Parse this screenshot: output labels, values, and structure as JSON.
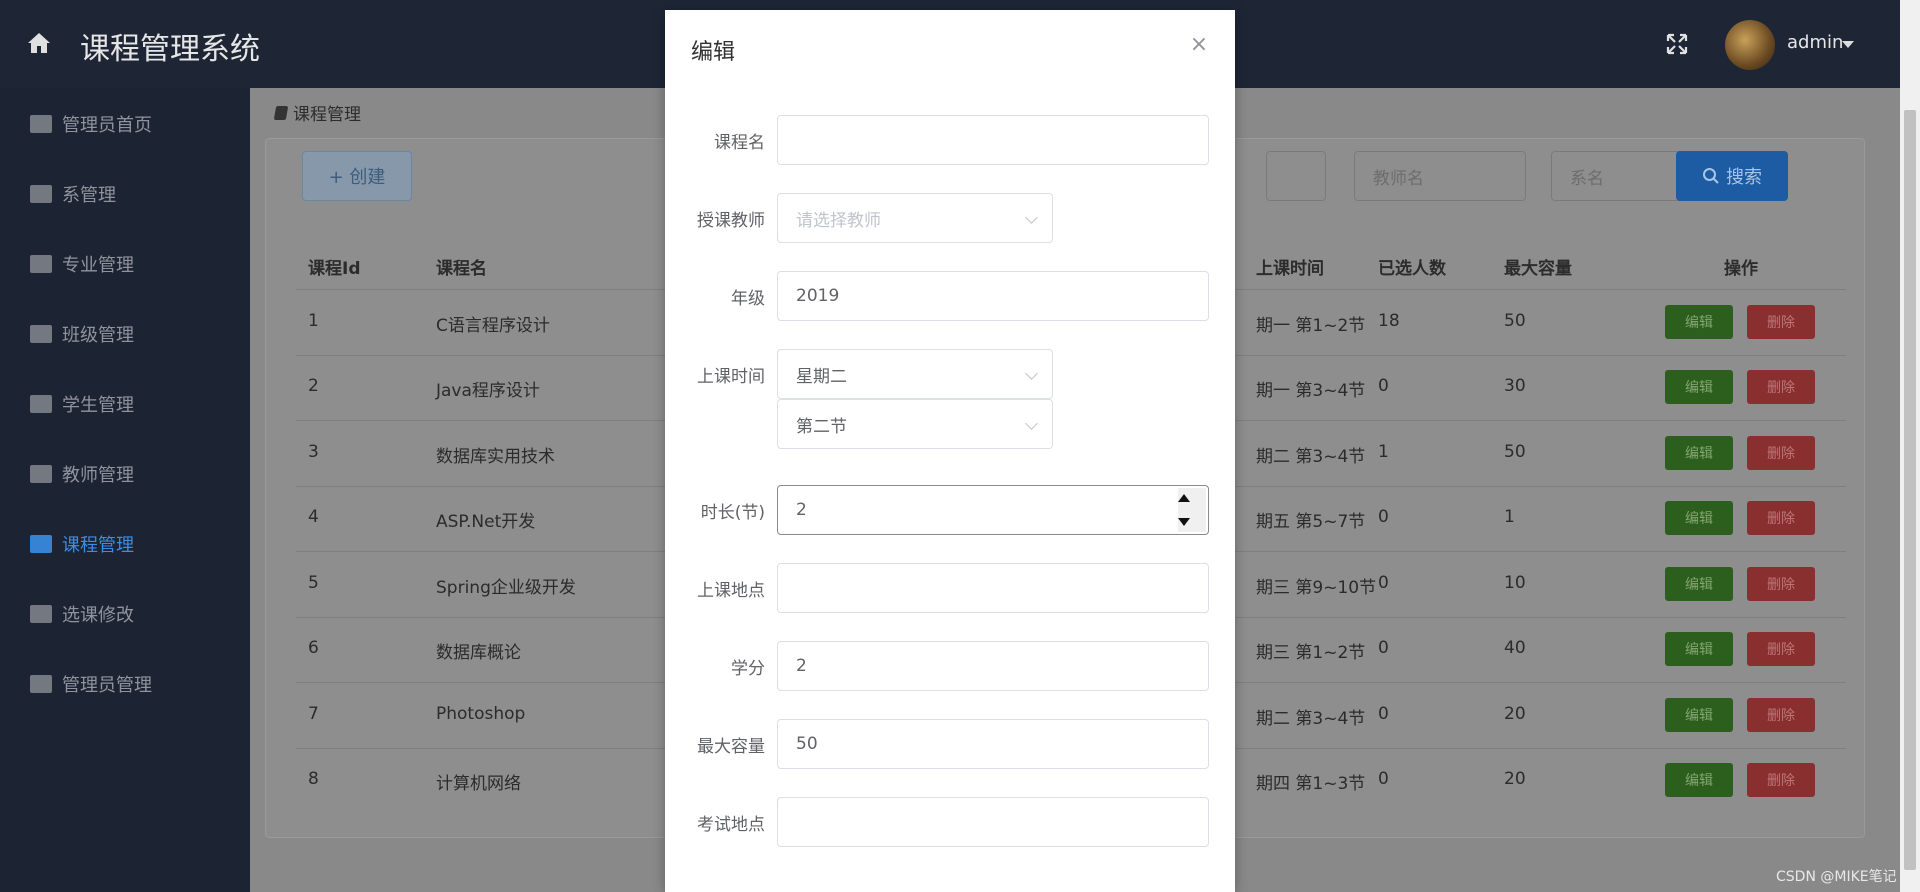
{
  "header": {
    "title": "课程管理系统",
    "user": "admin"
  },
  "sidebar": {
    "items": [
      {
        "label": "管理员首页",
        "icon": "bar-chart-icon"
      },
      {
        "label": "系管理",
        "icon": "sitemap-icon"
      },
      {
        "label": "专业管理",
        "icon": "graduation-cap-icon"
      },
      {
        "label": "班级管理",
        "icon": "users-icon"
      },
      {
        "label": "学生管理",
        "icon": "user-icon"
      },
      {
        "label": "教师管理",
        "icon": "user-plus-icon"
      },
      {
        "label": "课程管理",
        "icon": "book-icon",
        "active": true
      },
      {
        "label": "选课修改",
        "icon": "edit-icon"
      },
      {
        "label": "管理员管理",
        "icon": "id-badge-icon"
      }
    ]
  },
  "breadcrumb": {
    "label": "课程管理"
  },
  "toolbar": {
    "create_label": "+ 创建",
    "teacher_placeholder": "教师名",
    "dept_placeholder": "系名",
    "search_label": "搜索"
  },
  "table": {
    "headers": [
      "课程Id",
      "课程名",
      "上课时间",
      "已选人数",
      "最大容量",
      "操作"
    ],
    "rows": [
      {
        "id": "1",
        "name": "C语言程序设计",
        "time": "期一 第1~2节",
        "selected": "18",
        "max": "50"
      },
      {
        "id": "2",
        "name": "Java程序设计",
        "time": "期一 第3~4节",
        "selected": "0",
        "max": "30"
      },
      {
        "id": "3",
        "name": "数据库实用技术",
        "time": "期二 第3~4节",
        "selected": "1",
        "max": "50"
      },
      {
        "id": "4",
        "name": "ASP.Net开发",
        "time": "期五 第5~7节",
        "selected": "0",
        "max": "1"
      },
      {
        "id": "5",
        "name": "Spring企业级开发",
        "time": "期三 第9~10节",
        "selected": "0",
        "max": "10"
      },
      {
        "id": "6",
        "name": "数据库概论",
        "time": "期三 第1~2节",
        "selected": "0",
        "max": "40"
      },
      {
        "id": "7",
        "name": "Photoshop",
        "time": "期二 第3~4节",
        "selected": "0",
        "max": "20"
      },
      {
        "id": "8",
        "name": "计算机网络",
        "time": "期四 第1~3节",
        "selected": "0",
        "max": "20"
      }
    ],
    "edit_label": "编辑",
    "delete_label": "删除"
  },
  "modal": {
    "title": "编辑",
    "close": "×",
    "fields": {
      "course_name": {
        "label": "课程名",
        "value": ""
      },
      "teacher": {
        "label": "授课教师",
        "placeholder": "请选择教师"
      },
      "grade": {
        "label": "年级",
        "value": "2019"
      },
      "time": {
        "label": "上课时间",
        "weekday": "星期二",
        "period": "第二节"
      },
      "duration": {
        "label": "时长(节)",
        "value": "2"
      },
      "location": {
        "label": "上课地点",
        "value": ""
      },
      "credit": {
        "label": "学分",
        "value": "2"
      },
      "capacity": {
        "label": "最大容量",
        "value": "50"
      },
      "exam_location": {
        "label": "考试地点",
        "value": ""
      }
    }
  },
  "watermark": "CSDN @MIKE笔记"
}
